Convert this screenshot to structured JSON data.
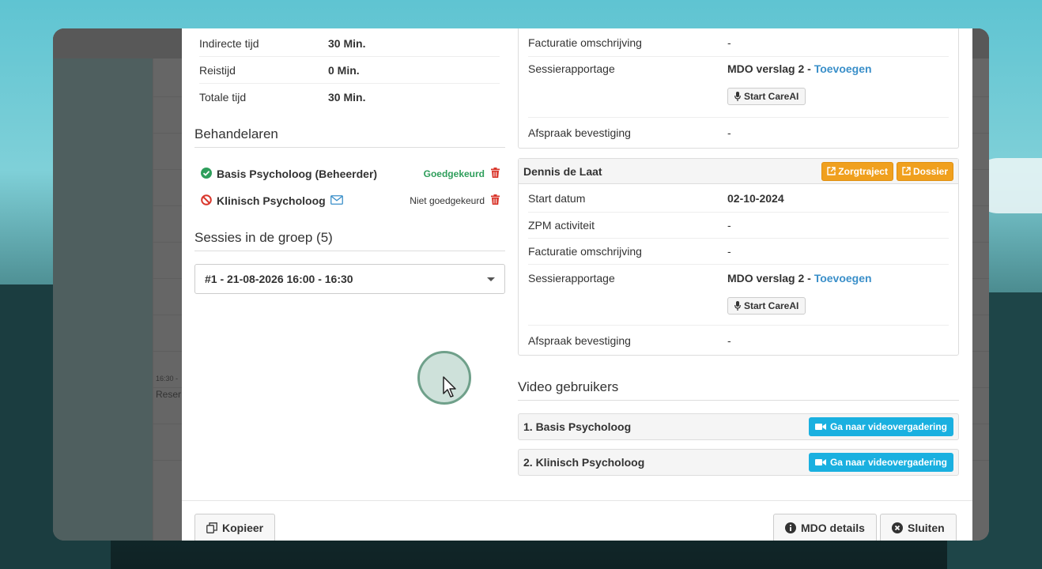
{
  "background_times": {
    "slot_time": "16:30 -",
    "slot_label": "Reser"
  },
  "left": {
    "time_rows": [
      {
        "label": "Indirecte tijd",
        "value": "30 Min."
      },
      {
        "label": "Reistijd",
        "value": "0 Min."
      },
      {
        "label": "Totale tijd",
        "value": "30 Min."
      }
    ],
    "therapists_title": "Behandelaren",
    "therapists": [
      {
        "name": "Basis Psycholoog (Beheerder)",
        "status": "Goedgekeurd",
        "status_color": "#2e9e5b"
      },
      {
        "name": "Klinisch Psycholoog",
        "status": "Niet goedgekeurd",
        "status_color": "#333333"
      }
    ],
    "sessions_title": "Sessies in de groep (5)",
    "session_select": "#1 - 21-08-2026 16:00 - 16:30"
  },
  "right": {
    "panel1": {
      "rows": [
        {
          "label": "Facturatie omschrijving",
          "value": "-"
        },
        {
          "label": "Sessierapportage",
          "value": "MDO verslag 2 - ",
          "link": "Toevoegen",
          "button": "Start CareAI"
        },
        {
          "label": "Afspraak bevestiging",
          "value": "-"
        }
      ]
    },
    "panel2": {
      "title": "Dennis de Laat",
      "btn_zorgtraject": "Zorgtraject",
      "btn_dossier": "Dossier",
      "rows": [
        {
          "label": "Start datum",
          "value": "02-10-2024"
        },
        {
          "label": "ZPM activiteit",
          "value": "-"
        },
        {
          "label": "Facturatie omschrijving",
          "value": "-"
        },
        {
          "label": "Sessierapportage",
          "value": "MDO verslag 2 - ",
          "link": "Toevoegen",
          "button": "Start CareAI"
        },
        {
          "label": "Afspraak bevestiging",
          "value": "-"
        }
      ]
    },
    "video_title": "Video gebruikers",
    "video_users": [
      {
        "name": "1. Basis Psycholoog",
        "button": "Ga naar videovergadering"
      },
      {
        "name": "2. Klinisch Psycholoog",
        "button": "Ga naar videovergadering"
      }
    ]
  },
  "footer": {
    "copy": "Kopieer",
    "details": "MDO details",
    "close": "Sluiten"
  },
  "colors": {
    "approved": "#2e9e5b",
    "danger": "#d9362b",
    "link": "#3a8fc9",
    "orange": "#f0a01e",
    "video_blue": "#1ab0e0"
  }
}
